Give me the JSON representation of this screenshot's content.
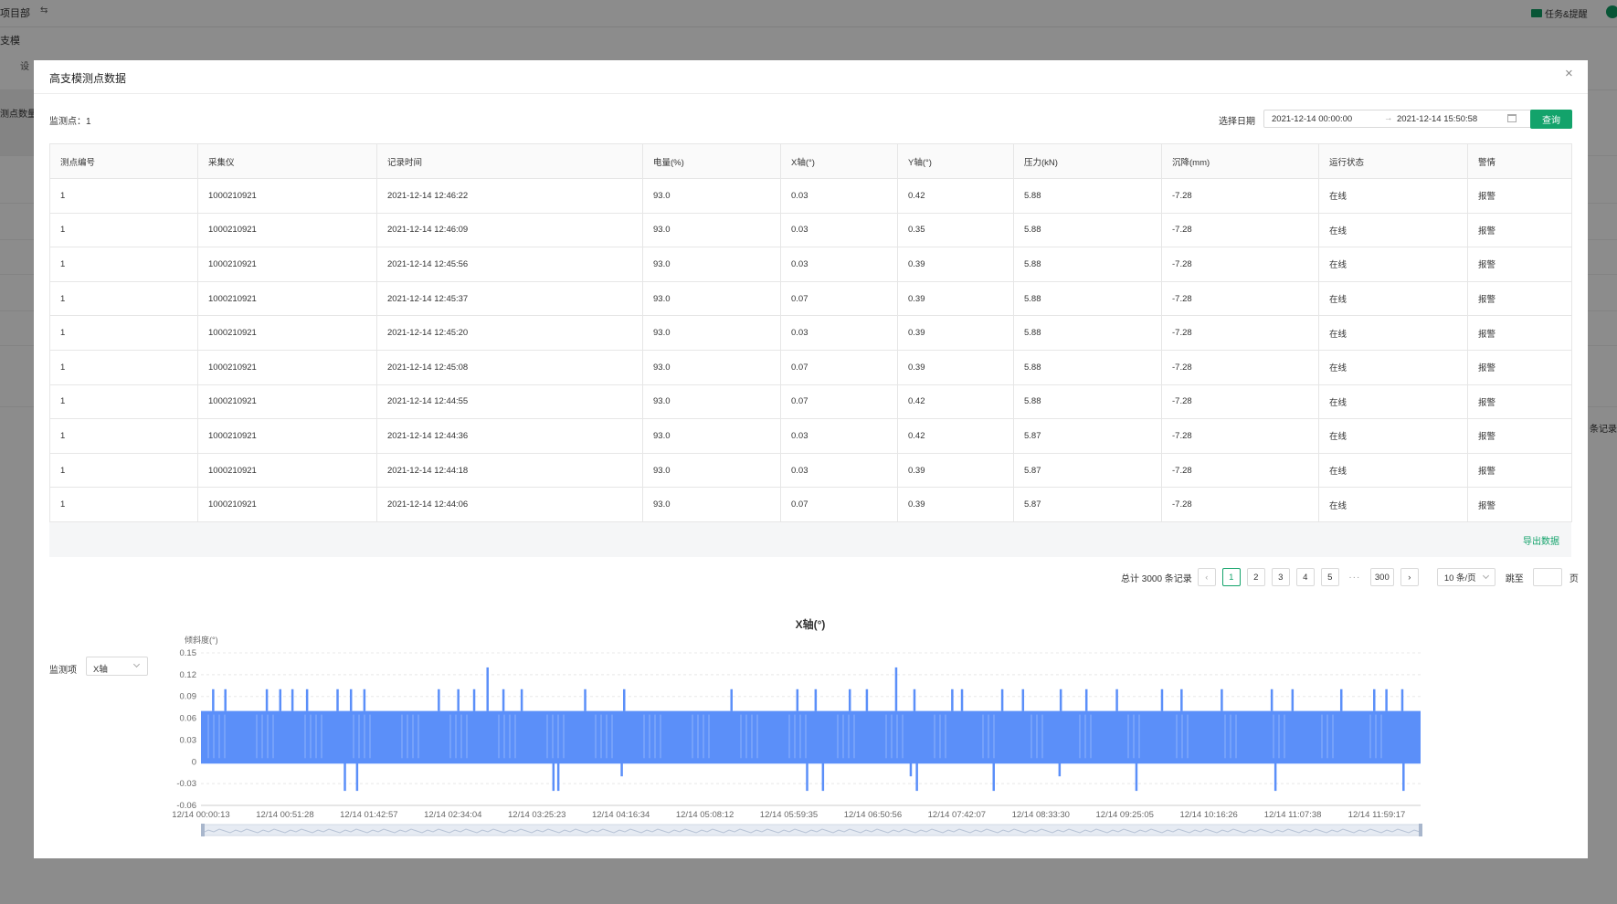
{
  "background": {
    "breadcrumb": "项目部",
    "subtab": "支模",
    "setting": "设",
    "stat_label": "测点数量",
    "tasks_label": "任务&提醒",
    "records_tail": "条记录"
  },
  "modal": {
    "title": "高支模测点数据",
    "close": "×",
    "point_label": "监测点：1",
    "date_label": "选择日期",
    "date_start": "2021-12-14 00:00:00",
    "date_sep": "→",
    "date_end": "2021-12-14 15:50:58",
    "query_button": "查询",
    "export_link": "导出数据",
    "monitor_label": "监测项",
    "monitor_value": "X轴"
  },
  "table": {
    "columns": [
      "测点编号",
      "采集仪",
      "记录时间",
      "电量(%)",
      "X轴(°)",
      "Y轴(°)",
      "压力(kN)",
      "沉降(mm)",
      "运行状态",
      "警情"
    ],
    "rows": [
      [
        "1",
        "1000210921",
        "2021-12-14 12:46:22",
        "93.0",
        "0.03",
        "0.42",
        "5.88",
        "-7.28",
        "在线",
        "报警"
      ],
      [
        "1",
        "1000210921",
        "2021-12-14 12:46:09",
        "93.0",
        "0.03",
        "0.35",
        "5.88",
        "-7.28",
        "在线",
        "报警"
      ],
      [
        "1",
        "1000210921",
        "2021-12-14 12:45:56",
        "93.0",
        "0.03",
        "0.39",
        "5.88",
        "-7.28",
        "在线",
        "报警"
      ],
      [
        "1",
        "1000210921",
        "2021-12-14 12:45:37",
        "93.0",
        "0.07",
        "0.39",
        "5.88",
        "-7.28",
        "在线",
        "报警"
      ],
      [
        "1",
        "1000210921",
        "2021-12-14 12:45:20",
        "93.0",
        "0.03",
        "0.39",
        "5.88",
        "-7.28",
        "在线",
        "报警"
      ],
      [
        "1",
        "1000210921",
        "2021-12-14 12:45:08",
        "93.0",
        "0.07",
        "0.39",
        "5.88",
        "-7.28",
        "在线",
        "报警"
      ],
      [
        "1",
        "1000210921",
        "2021-12-14 12:44:55",
        "93.0",
        "0.07",
        "0.42",
        "5.88",
        "-7.28",
        "在线",
        "报警"
      ],
      [
        "1",
        "1000210921",
        "2021-12-14 12:44:36",
        "93.0",
        "0.03",
        "0.42",
        "5.87",
        "-7.28",
        "在线",
        "报警"
      ],
      [
        "1",
        "1000210921",
        "2021-12-14 12:44:18",
        "93.0",
        "0.03",
        "0.39",
        "5.87",
        "-7.28",
        "在线",
        "报警"
      ],
      [
        "1",
        "1000210921",
        "2021-12-14 12:44:06",
        "93.0",
        "0.07",
        "0.39",
        "5.87",
        "-7.28",
        "在线",
        "报警"
      ]
    ]
  },
  "pagination": {
    "total": "总计 3000 条记录",
    "prev": "‹",
    "pages": [
      "1",
      "2",
      "3",
      "4",
      "5"
    ],
    "current": "1",
    "ellipsis": "···",
    "last": "300",
    "next": "›",
    "page_size": "10 条/页",
    "jump_label": "跳至",
    "jump_suffix": "页"
  },
  "chart_data": {
    "type": "line",
    "title": "X轴(°)",
    "ylabel": "倾斜度(°)",
    "ylim": [
      -0.06,
      0.15
    ],
    "yticks": [
      "0.15",
      "0.12",
      "0.09",
      "0.06",
      "0.03",
      "0",
      "-0.03",
      "-0.06"
    ],
    "xticks": [
      "12/14 00:00:13",
      "12/14 00:51:28",
      "12/14 01:42:57",
      "12/14 02:34:04",
      "12/14 03:25:23",
      "12/14 04:16:34",
      "12/14 05:08:12",
      "12/14 05:59:35",
      "12/14 06:50:56",
      "12/14 07:42:07",
      "12/14 08:33:30",
      "12/14 09:25:05",
      "12/14 10:16:26",
      "12/14 11:07:38",
      "12/14 11:59:17"
    ],
    "band_high": 0.07,
    "band_low": 0.0,
    "spikes_up": [
      {
        "t": 0.01,
        "v": 0.1
      },
      {
        "t": 0.02,
        "v": 0.1
      },
      {
        "t": 0.054,
        "v": 0.1
      },
      {
        "t": 0.065,
        "v": 0.1
      },
      {
        "t": 0.075,
        "v": 0.1
      },
      {
        "t": 0.087,
        "v": 0.1
      },
      {
        "t": 0.112,
        "v": 0.1
      },
      {
        "t": 0.123,
        "v": 0.1
      },
      {
        "t": 0.134,
        "v": 0.1
      },
      {
        "t": 0.195,
        "v": 0.1
      },
      {
        "t": 0.211,
        "v": 0.1
      },
      {
        "t": 0.224,
        "v": 0.1
      },
      {
        "t": 0.235,
        "v": 0.13
      },
      {
        "t": 0.248,
        "v": 0.1
      },
      {
        "t": 0.263,
        "v": 0.1
      },
      {
        "t": 0.315,
        "v": 0.1
      },
      {
        "t": 0.347,
        "v": 0.1
      },
      {
        "t": 0.435,
        "v": 0.1
      },
      {
        "t": 0.489,
        "v": 0.1
      },
      {
        "t": 0.504,
        "v": 0.1
      },
      {
        "t": 0.532,
        "v": 0.1
      },
      {
        "t": 0.546,
        "v": 0.1
      },
      {
        "t": 0.57,
        "v": 0.13
      },
      {
        "t": 0.585,
        "v": 0.1
      },
      {
        "t": 0.616,
        "v": 0.1
      },
      {
        "t": 0.624,
        "v": 0.1
      },
      {
        "t": 0.657,
        "v": 0.1
      },
      {
        "t": 0.674,
        "v": 0.1
      },
      {
        "t": 0.705,
        "v": 0.1
      },
      {
        "t": 0.726,
        "v": 0.1
      },
      {
        "t": 0.751,
        "v": 0.1
      },
      {
        "t": 0.788,
        "v": 0.1
      },
      {
        "t": 0.804,
        "v": 0.1
      },
      {
        "t": 0.837,
        "v": 0.1
      },
      {
        "t": 0.878,
        "v": 0.1
      },
      {
        "t": 0.895,
        "v": 0.1
      },
      {
        "t": 0.935,
        "v": 0.1
      },
      {
        "t": 0.962,
        "v": 0.1
      },
      {
        "t": 0.972,
        "v": 0.1
      },
      {
        "t": 0.985,
        "v": 0.1
      }
    ],
    "spikes_down": [
      {
        "t": 0.118,
        "v": -0.04
      },
      {
        "t": 0.128,
        "v": -0.04
      },
      {
        "t": 0.289,
        "v": -0.04
      },
      {
        "t": 0.293,
        "v": -0.04
      },
      {
        "t": 0.345,
        "v": -0.02
      },
      {
        "t": 0.497,
        "v": -0.04
      },
      {
        "t": 0.51,
        "v": -0.04
      },
      {
        "t": 0.582,
        "v": -0.02
      },
      {
        "t": 0.587,
        "v": -0.04
      },
      {
        "t": 0.65,
        "v": -0.04
      },
      {
        "t": 0.704,
        "v": -0.02
      },
      {
        "t": 0.767,
        "v": -0.04
      },
      {
        "t": 0.881,
        "v": -0.04
      },
      {
        "t": 0.986,
        "v": -0.04
      }
    ]
  }
}
